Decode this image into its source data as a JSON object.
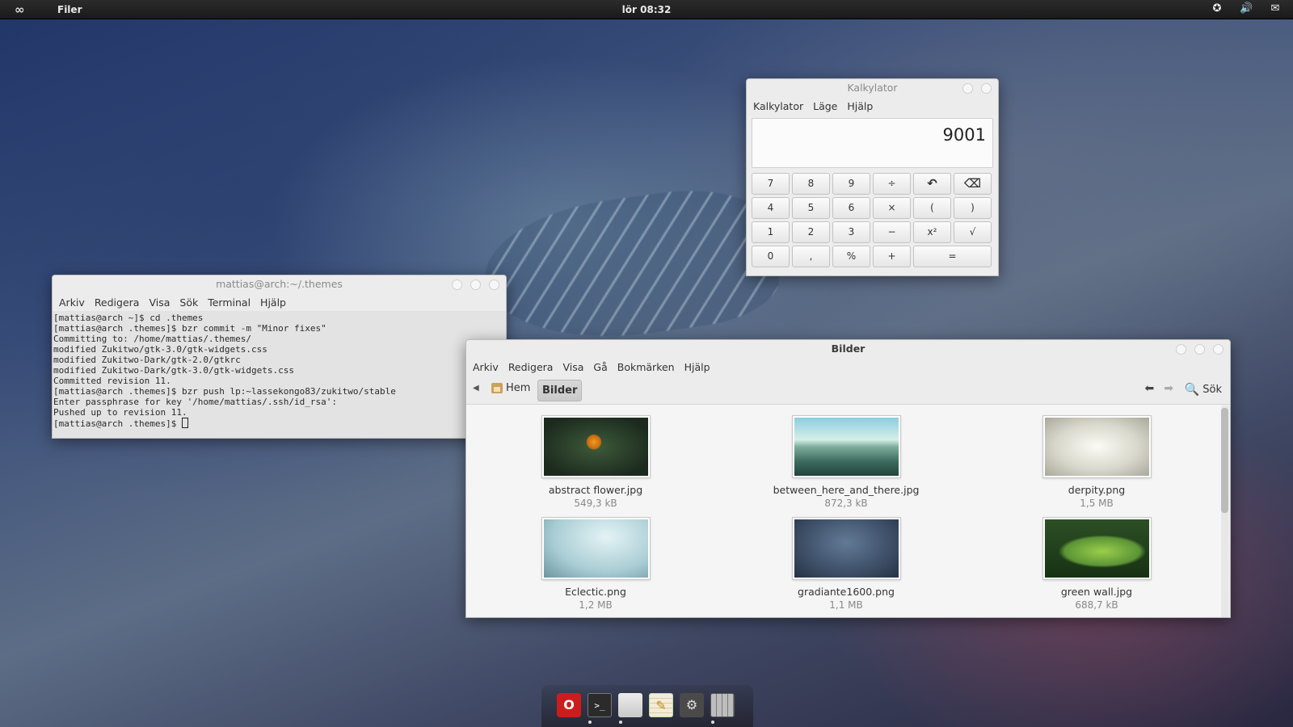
{
  "top_panel": {
    "app_name": "Filer",
    "clock": "lör 08:32",
    "tray": [
      "accessibility-icon",
      "volume-icon",
      "messaging-icon"
    ]
  },
  "terminal": {
    "title": "mattias@arch:~/.themes",
    "menu": [
      "Arkiv",
      "Redigera",
      "Visa",
      "Sök",
      "Terminal",
      "Hjälp"
    ],
    "lines": [
      "[mattias@arch ~]$ cd .themes",
      "[mattias@arch .themes]$ bzr commit -m \"Minor fixes\"",
      "Committing to: /home/mattias/.themes/",
      "modified Zukitwo/gtk-3.0/gtk-widgets.css",
      "modified Zukitwo-Dark/gtk-2.0/gtkrc",
      "modified Zukitwo-Dark/gtk-3.0/gtk-widgets.css",
      "Committed revision 11.",
      "[mattias@arch .themes]$ bzr push lp:~lassekongo83/zukitwo/stable",
      "Enter passphrase for key '/home/mattias/.ssh/id_rsa':",
      "Pushed up to revision 11.",
      "[mattias@arch .themes]$ "
    ]
  },
  "calculator": {
    "title": "Kalkylator",
    "menu": [
      "Kalkylator",
      "Läge",
      "Hjälp"
    ],
    "display": "9001",
    "keys": [
      "7",
      "8",
      "9",
      "÷",
      "↶",
      "⌫",
      "4",
      "5",
      "6",
      "×",
      "(",
      ")",
      "1",
      "2",
      "3",
      "−",
      "x²",
      "√",
      "0",
      ",",
      "%",
      "+",
      "="
    ]
  },
  "files": {
    "title": "Bilder",
    "menu": [
      "Arkiv",
      "Redigera",
      "Visa",
      "Gå",
      "Bokmärken",
      "Hjälp"
    ],
    "crumbs": [
      "Hem",
      "Bilder"
    ],
    "search_label": "Sök",
    "items": [
      {
        "name": "abstract flower.jpg",
        "size": "549,3 kB"
      },
      {
        "name": "between_here_and_there.jpg",
        "size": "872,3 kB"
      },
      {
        "name": "derpity.png",
        "size": "1,5 MB"
      },
      {
        "name": "Eclectic.png",
        "size": "1,2 MB"
      },
      {
        "name": "gradiante1600.png",
        "size": "1,1 MB"
      },
      {
        "name": "green wall.jpg",
        "size": "688,7 kB"
      }
    ]
  },
  "dock": {
    "items": [
      "opera-icon",
      "terminal-icon",
      "files-icon",
      "text-editor-icon",
      "settings-icon",
      "calculator-icon"
    ],
    "opera_glyph": "O",
    "terminal_glyph": ">_",
    "accent_colors": {
      "opera": "#cc1d1d",
      "terminal": "#2b2b2b",
      "files": "#d7d7d7",
      "editor": "#efe6c9",
      "settings": "#4a4a4a",
      "calculator": "#6a6a6a"
    }
  }
}
